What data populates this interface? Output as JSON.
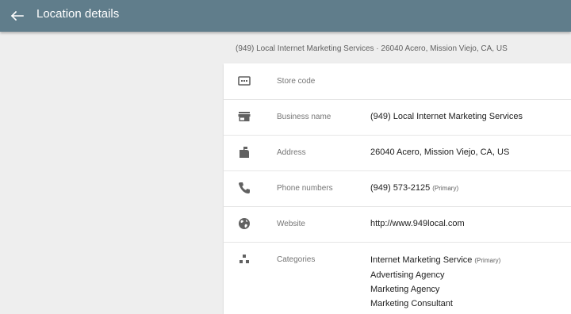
{
  "header": {
    "title": "Location details",
    "back_icon": "arrow-back-icon"
  },
  "subtitle": "(949) Local Internet Marketing Services · 26040 Acero, Mission Viejo, CA, US",
  "colors": {
    "app_bar": "#607d8b",
    "icon": "#616161"
  },
  "rows": [
    {
      "icon": "store-code-icon",
      "label": "Store code",
      "value": ""
    },
    {
      "icon": "storefront-icon",
      "label": "Business name",
      "value": "(949) Local Internet Marketing Services"
    },
    {
      "icon": "mailbox-icon",
      "label": "Address",
      "value": "26040 Acero, Mission Viejo, CA, US"
    },
    {
      "icon": "phone-icon",
      "label": "Phone numbers",
      "value": "(949) 573-2125",
      "tag": "(Primary)"
    },
    {
      "icon": "globe-icon",
      "label": "Website",
      "value": "http://www.949local.com"
    },
    {
      "icon": "categories-icon",
      "label": "Categories",
      "values": [
        {
          "text": "Internet Marketing Service",
          "tag": "(Primary)"
        },
        {
          "text": "Advertising Agency"
        },
        {
          "text": "Marketing Agency"
        },
        {
          "text": "Marketing Consultant"
        }
      ]
    }
  ]
}
